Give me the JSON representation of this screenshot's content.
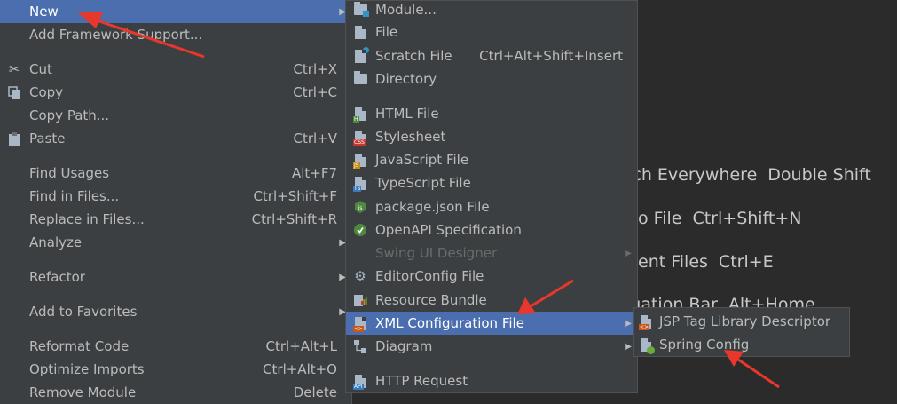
{
  "background_hints": [
    {
      "label": "rch Everywhere",
      "shortcut": "Double Shift"
    },
    {
      "label": "o File",
      "shortcut": "Ctrl+Shift+N"
    },
    {
      "label": "ent Files",
      "shortcut": "Ctrl+E"
    },
    {
      "label": "igation Bar",
      "shortcut": "Alt+Home"
    }
  ],
  "context_menu": {
    "new": "New",
    "add_framework": "Add Framework Support...",
    "cut": {
      "label": "Cut",
      "shortcut": "Ctrl+X"
    },
    "copy": {
      "label": "Copy",
      "shortcut": "Ctrl+C"
    },
    "copy_path": "Copy Path...",
    "paste": {
      "label": "Paste",
      "shortcut": "Ctrl+V"
    },
    "find_usages": {
      "label": "Find Usages",
      "shortcut": "Alt+F7"
    },
    "find_in_files": {
      "label": "Find in Files...",
      "shortcut": "Ctrl+Shift+F"
    },
    "replace_in_files": {
      "label": "Replace in Files...",
      "shortcut": "Ctrl+Shift+R"
    },
    "analyze": "Analyze",
    "refactor": "Refactor",
    "add_to_favorites": "Add to Favorites",
    "reformat_code": {
      "label": "Reformat Code",
      "shortcut": "Ctrl+Alt+L"
    },
    "optimize_imports": {
      "label": "Optimize Imports",
      "shortcut": "Ctrl+Alt+O"
    },
    "remove_module": {
      "label": "Remove Module",
      "shortcut": "Delete"
    }
  },
  "new_submenu": {
    "module": "Module...",
    "file": "File",
    "scratch_file": {
      "label": "Scratch File",
      "shortcut": "Ctrl+Alt+Shift+Insert"
    },
    "directory": "Directory",
    "html_file": "HTML File",
    "stylesheet": "Stylesheet",
    "javascript_file": "JavaScript File",
    "typescript_file": "TypeScript File",
    "package_json": "package.json File",
    "openapi": "OpenAPI Specification",
    "swing_ui": "Swing UI Designer",
    "editorconfig": "EditorConfig File",
    "resource_bundle": "Resource Bundle",
    "xml_config": "XML Configuration File",
    "diagram": "Diagram",
    "http_request": "HTTP Request"
  },
  "xml_submenu": {
    "jsp_tag": "JSP Tag Library Descriptor",
    "spring_config": "Spring Config"
  },
  "icon_badges": {
    "html": "H",
    "css": "CSS",
    "js": "JS",
    "ts": "TS",
    "api": "API"
  },
  "colors": {
    "selection": "#4b6eaf",
    "menu_bg": "#3c3f41",
    "annotation_arrow": "#e8372c"
  }
}
